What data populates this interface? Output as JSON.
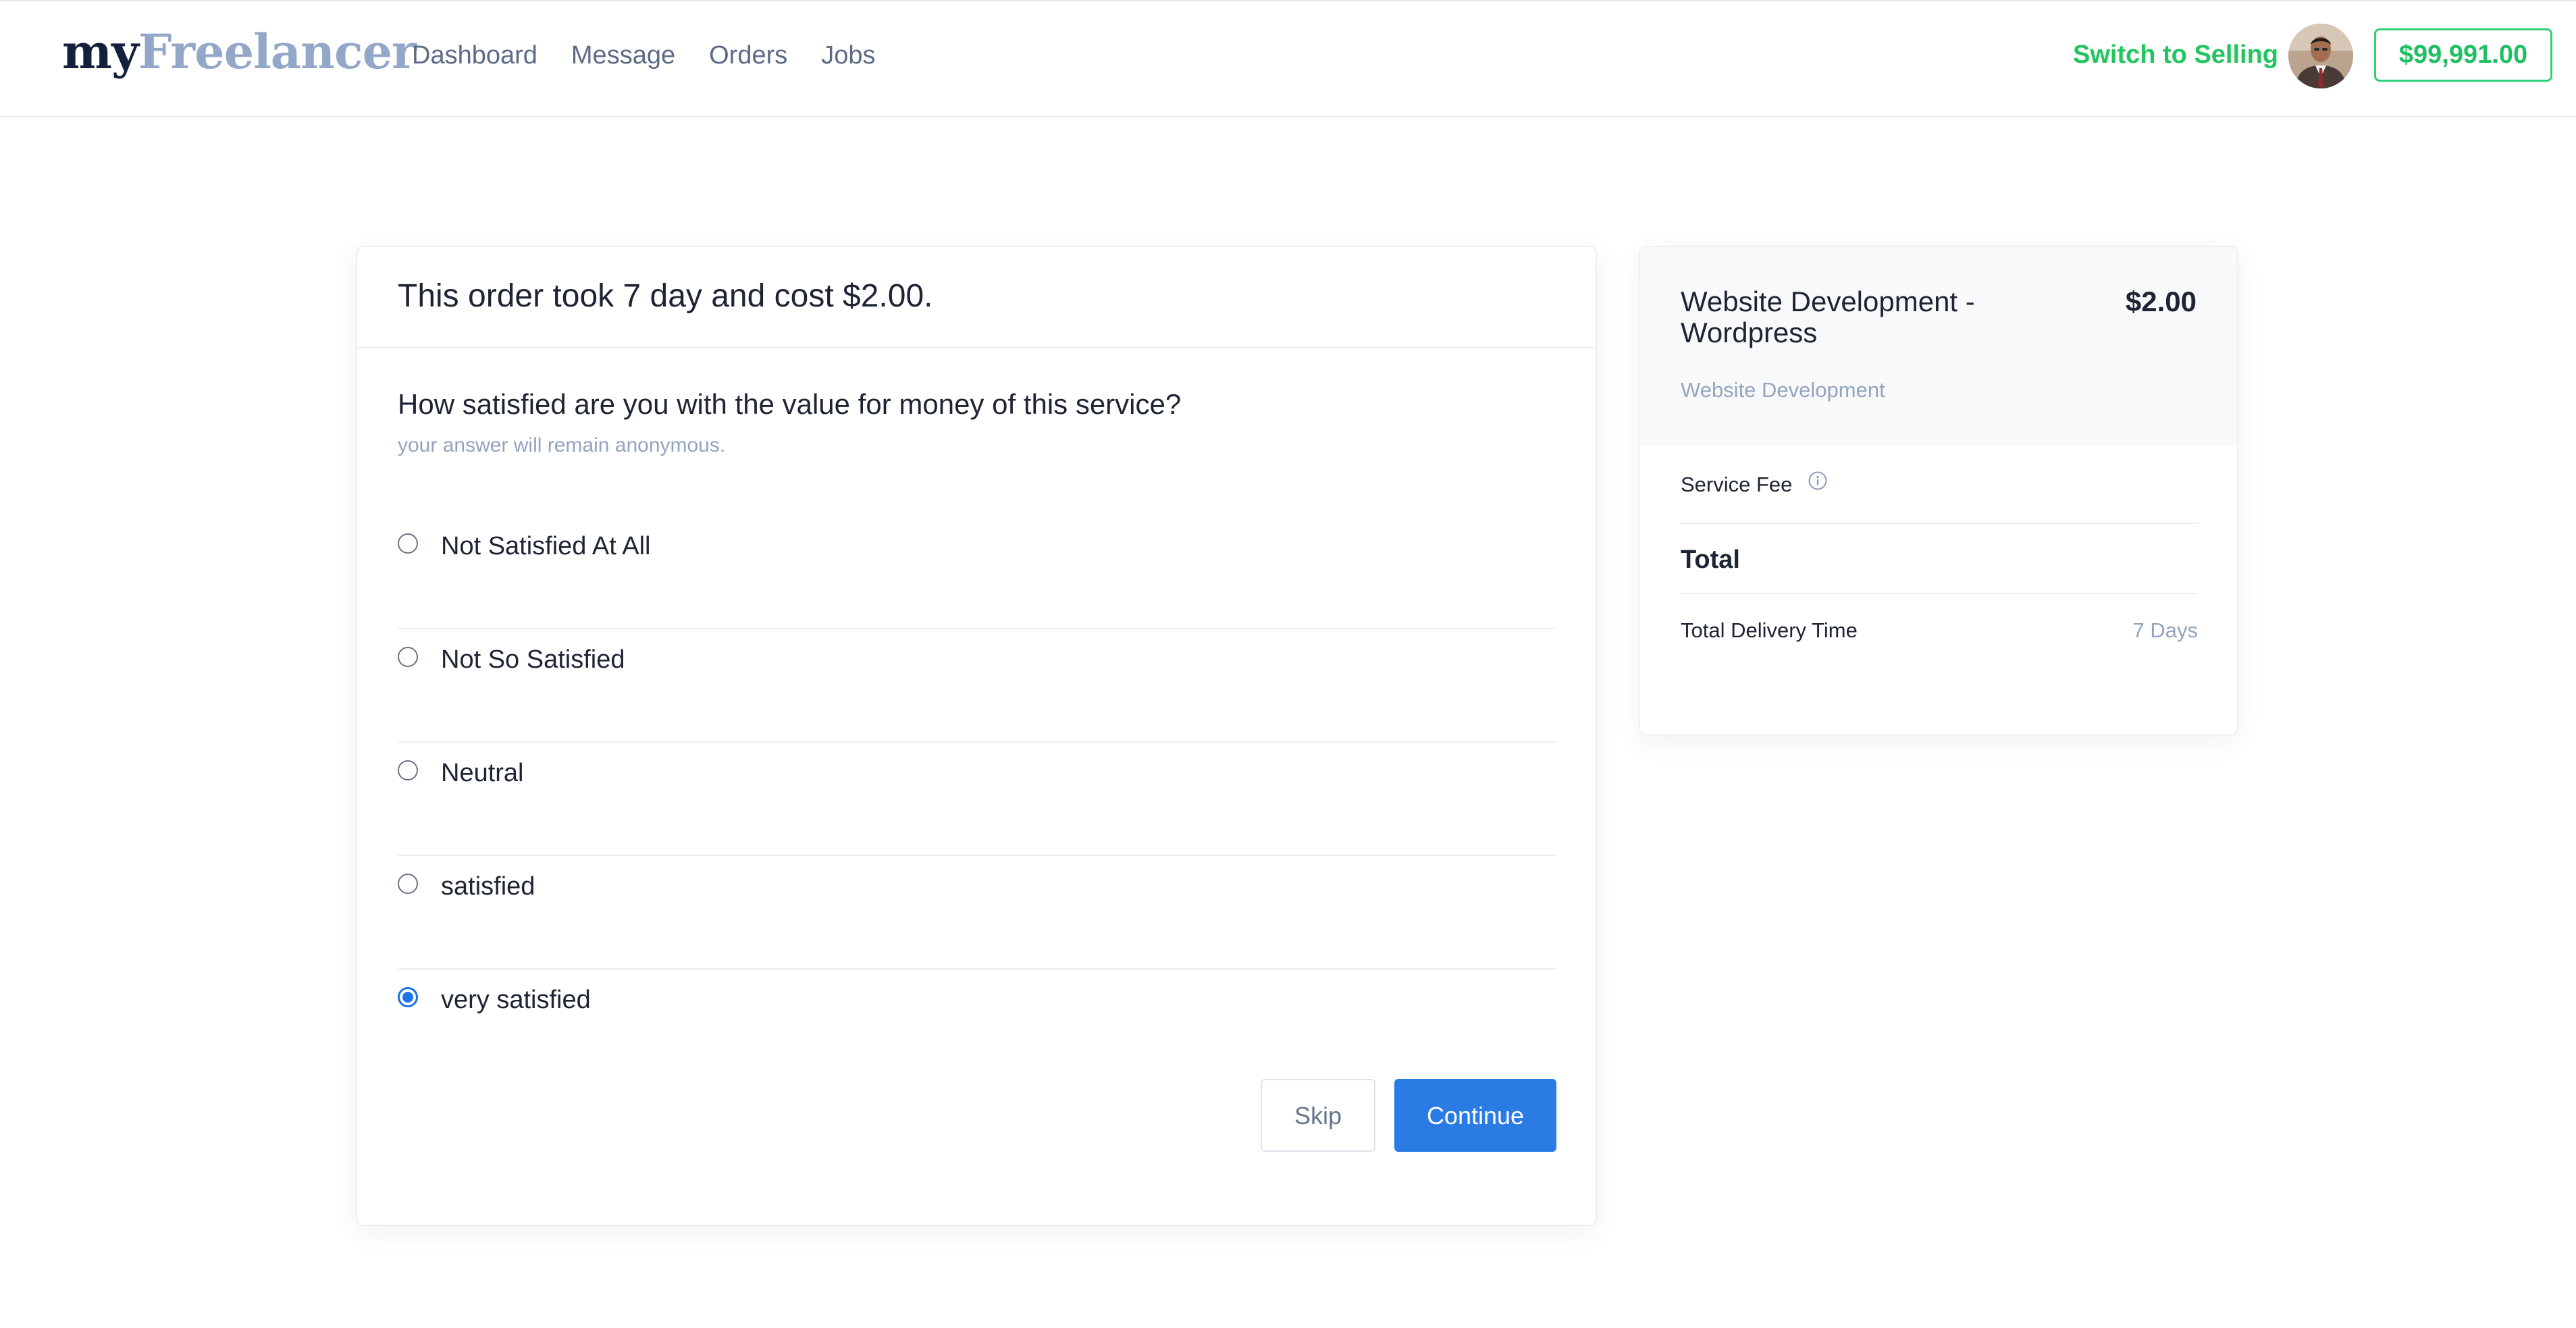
{
  "header": {
    "logo_my": "my",
    "logo_freelancer": "Freelancer",
    "nav": [
      {
        "label": "Dashboard"
      },
      {
        "label": "Message"
      },
      {
        "label": "Orders"
      },
      {
        "label": "Jobs"
      }
    ],
    "switch_label": "Switch to Selling",
    "balance": "$99,991.00"
  },
  "feedback": {
    "order_summary": "This order took 7 day and cost $2.00.",
    "question": "How satisfied are you with the value for money of this service?",
    "note": "your answer will remain anonymous.",
    "options": [
      {
        "label": "Not Satisfied At All"
      },
      {
        "label": "Not So Satisfied"
      },
      {
        "label": "Neutral"
      },
      {
        "label": "satisfied"
      },
      {
        "label": "very satisfied"
      }
    ],
    "selected_option": "very satisfied",
    "skip_label": "Skip",
    "continue_label": "Continue"
  },
  "summary": {
    "service_title": "Website Development - Wordpress",
    "service_price": "$2.00",
    "service_category": "Website Development",
    "service_fee_label": "Service Fee",
    "total_label": "Total",
    "delivery_label": "Total Delivery Time",
    "delivery_value": "7 Days"
  },
  "colors": {
    "accent_blue": "#2a7be4",
    "green": "#22c55e",
    "muted": "#93a4bf",
    "text": "#1e2433"
  },
  "icons": {
    "info": "info-circle-icon",
    "avatar": "user-avatar"
  }
}
